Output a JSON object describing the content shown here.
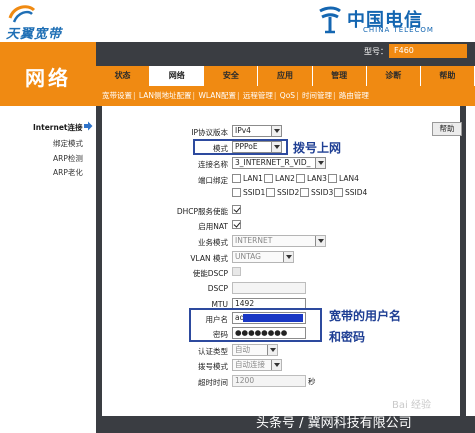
{
  "header": {
    "brand_left": "天翼宽带",
    "brand_right_cn": "中国电信",
    "brand_right_en": "CHINA TELECOM",
    "model_label": "型号：",
    "model_value": "F460"
  },
  "section_title": "网络",
  "tabs": [
    {
      "label": "状态",
      "active": false
    },
    {
      "label": "网络",
      "active": true
    },
    {
      "label": "安全",
      "active": false
    },
    {
      "label": "应用",
      "active": false
    },
    {
      "label": "管理",
      "active": false
    },
    {
      "label": "诊断",
      "active": false
    },
    {
      "label": "帮助",
      "active": false
    }
  ],
  "subtabs": [
    "宽带设置",
    "LAN侧地址配置",
    "WLAN配置",
    "远程管理",
    "QoS",
    "时间管理",
    "路由管理"
  ],
  "sidebar": {
    "items": [
      "Internet连接",
      "绑定模式",
      "ARP检测",
      "ARP老化"
    ]
  },
  "help_label": "帮助",
  "form": {
    "ip_version": {
      "label": "IP协议版本",
      "value": "IPv4"
    },
    "mode": {
      "label": "模式",
      "value": "PPPoE"
    },
    "connection_name": {
      "label": "连接名称",
      "value": "3_INTERNET_R_VID_"
    },
    "port_binding": {
      "label": "端口绑定",
      "lan": [
        "LAN1",
        "LAN2",
        "LAN3",
        "LAN4"
      ],
      "ssid": [
        "SSID1",
        "SSID2",
        "SSID3",
        "SSID4"
      ]
    },
    "dhcp": {
      "label": "DHCP服务使能"
    },
    "nat": {
      "label": "启用NAT"
    },
    "service_mode": {
      "label": "业务模式",
      "value": "INTERNET"
    },
    "vlan_mode": {
      "label": "VLAN 模式",
      "value": "UNTAG"
    },
    "dscp_enable": {
      "label": "使能DSCP"
    },
    "dscp": {
      "label": "DSCP",
      "value": ""
    },
    "mtu": {
      "label": "MTU",
      "value": "1492"
    },
    "username": {
      "label": "用户名",
      "value": "ad"
    },
    "password": {
      "label": "密码",
      "value": "●●●●●●●●"
    },
    "auth_type": {
      "label": "认证类型",
      "value": "自动"
    },
    "dial_mode": {
      "label": "拨号模式",
      "value": "自动连接"
    },
    "timeout": {
      "label": "超时时间",
      "value": "1200",
      "unit": "秒"
    }
  },
  "annotations": {
    "dial": "拨号上网",
    "account_line1": "宽带的用户名",
    "account_line2": "和密码"
  },
  "watermark": "头条号 / 冀网科技有限公司",
  "baidu_mark": "Bai 经验",
  "colors": {
    "orange": "#f08a12",
    "dark": "#3a3d42",
    "annotation_blue": "#2d4a9e"
  }
}
